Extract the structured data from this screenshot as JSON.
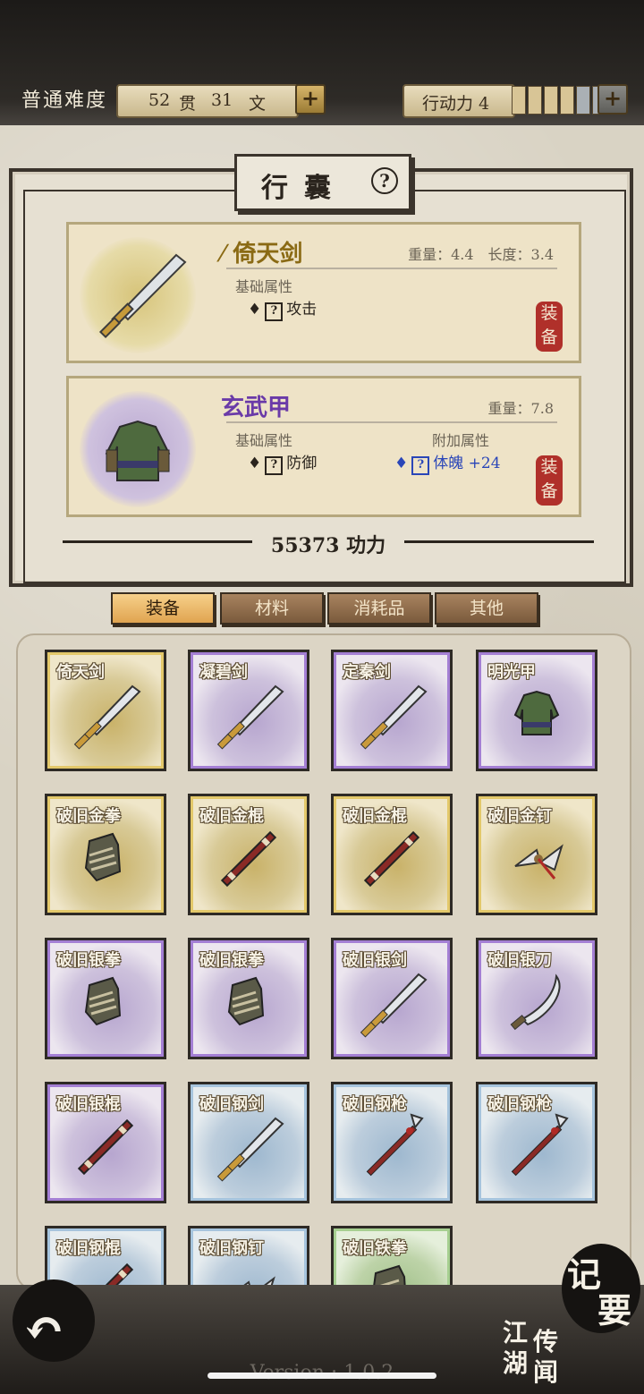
{
  "topbar": {
    "difficulty": "普通难度",
    "money_amount1": "52",
    "money_unit1": "贯",
    "money_amount2": "31",
    "money_unit2": "文",
    "energy_label": "行动力 4",
    "energy_segments_filled": 4,
    "energy_segments_total": 6
  },
  "panel": {
    "title": "行囊",
    "help_label": "?",
    "weapon": {
      "name": "倚天剑",
      "weight": "重量：4.4",
      "length": "长度：3.4",
      "base_attr_label": "基础属性",
      "base_attr_value": "攻击",
      "equip_label": "装备"
    },
    "armor": {
      "name": "玄武甲",
      "weight": "重量：7.8",
      "base_attr_label": "基础属性",
      "base_attr_value": "防御",
      "extra_attr_label": "附加属性",
      "extra_attr_value": "体魄 +24",
      "equip_label": "装备"
    },
    "power": "55373 功力"
  },
  "tabs": [
    {
      "label": "装备",
      "active": true
    },
    {
      "label": "材料",
      "active": false
    },
    {
      "label": "消耗品",
      "active": false
    },
    {
      "label": "其他",
      "active": false
    }
  ],
  "items": [
    {
      "name": "倚天剑",
      "rarity": "gold",
      "icon": "sword-icon"
    },
    {
      "name": "凝碧剑",
      "rarity": "purple",
      "icon": "sword-icon"
    },
    {
      "name": "定秦剑",
      "rarity": "purple",
      "icon": "sword-icon"
    },
    {
      "name": "明光甲",
      "rarity": "purple",
      "icon": "armor-icon"
    },
    {
      "name": "破旧金拳",
      "rarity": "gold",
      "icon": "gauntlet-icon"
    },
    {
      "name": "破旧金棍",
      "rarity": "gold",
      "icon": "staff-icon"
    },
    {
      "name": "破旧金棍",
      "rarity": "gold",
      "icon": "staff-icon"
    },
    {
      "name": "破旧金钉",
      "rarity": "gold",
      "icon": "dart-icon"
    },
    {
      "name": "破旧银拳",
      "rarity": "purple",
      "icon": "gauntlet-icon"
    },
    {
      "name": "破旧银拳",
      "rarity": "purple",
      "icon": "gauntlet-icon"
    },
    {
      "name": "破旧银剑",
      "rarity": "purple",
      "icon": "sword-icon"
    },
    {
      "name": "破旧银刀",
      "rarity": "purple",
      "icon": "saber-icon"
    },
    {
      "name": "破旧银棍",
      "rarity": "purple",
      "icon": "staff-icon"
    },
    {
      "name": "破旧钢剑",
      "rarity": "blue",
      "icon": "sword-icon"
    },
    {
      "name": "破旧钢枪",
      "rarity": "blue",
      "icon": "spear-icon"
    },
    {
      "name": "破旧钢枪",
      "rarity": "blue",
      "icon": "spear-icon"
    },
    {
      "name": "破旧钢棍",
      "rarity": "blue",
      "icon": "staff-icon"
    },
    {
      "name": "破旧钢钉",
      "rarity": "blue",
      "icon": "dart-icon"
    },
    {
      "name": "破旧铁拳",
      "rarity": "green",
      "icon": "gauntlet-icon"
    }
  ],
  "bottom": {
    "jiyao_1": "记",
    "jiyao_2": "要",
    "jianghu_1": "江",
    "jianghu_2": "湖",
    "chuanwen_1": "传",
    "chuanwen_2": "闻",
    "version": "Version : 1.0.2"
  }
}
